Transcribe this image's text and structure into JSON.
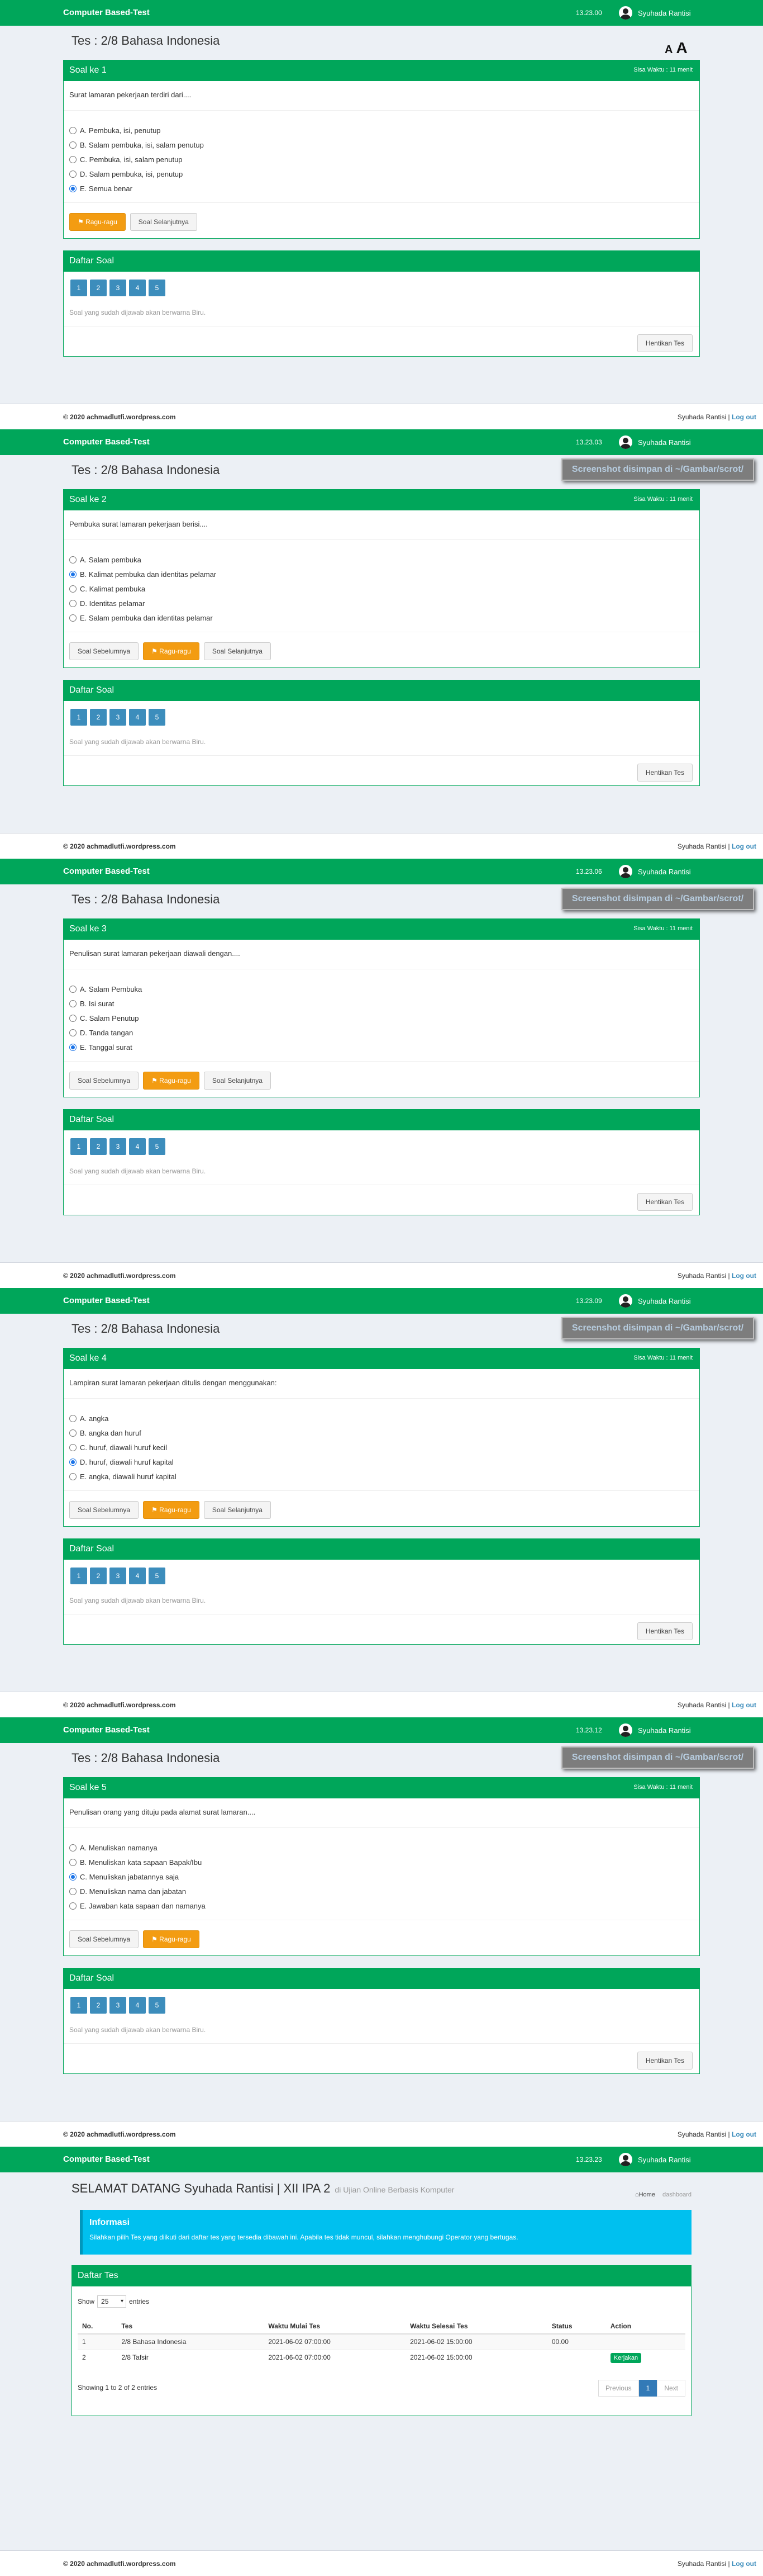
{
  "app": {
    "brand": "Computer Based-Test",
    "user": "Syuhada Rantisi",
    "logout": "Log out",
    "copyright": "© 2020 achmadlutfi.wordpress.com",
    "separator": "|"
  },
  "exam": {
    "title": "Tes : 2/8 Bahasa Indonesia",
    "font_small": "A",
    "font_big": "A",
    "list_title": "Daftar Soal",
    "list_note": "Soal yang sudah dijawab akan berwarna Biru.",
    "stop_button": "Hentikan Tes",
    "prev_button": "Soal Sebelumnya",
    "doubt_button": "Ragu-ragu",
    "next_button": "Soal Selanjutnya",
    "watermark": "Screenshot disimpan di ~/Gambar/scrot/",
    "numbers": [
      "1",
      "2",
      "3",
      "4",
      "5"
    ]
  },
  "questions": [
    {
      "clock": "13.23.00",
      "heading": "Soal ke 1",
      "time_left": "Sisa Waktu : 11 menit",
      "text": "Surat lamaran pekerjaan terdiri dari....",
      "options": [
        "A. Pembuka, isi, penutup",
        "B. Salam pembuka, isi, salam penutup",
        "C. Pembuka, isi, salam penutup",
        "D. Salam pembuka, isi, penutup",
        "E. Semua benar"
      ],
      "selected": 4
    },
    {
      "clock": "13.23.03",
      "heading": "Soal ke 2",
      "time_left": "Sisa Waktu : 11 menit",
      "text": "Pembuka surat lamaran pekerjaan berisi....",
      "options": [
        "A. Salam pembuka",
        "B. Kalimat pembuka dan identitas pelamar",
        "C. Kalimat pembuka",
        "D. Identitas pelamar",
        "E. Salam pembuka dan identitas pelamar"
      ],
      "selected": 1
    },
    {
      "clock": "13.23.06",
      "heading": "Soal ke 3",
      "time_left": "Sisa Waktu : 11 menit",
      "text": "Penulisan surat lamaran pekerjaan diawali dengan....",
      "options": [
        "A. Salam Pembuka",
        "B. Isi surat",
        "C. Salam Penutup",
        "D. Tanda tangan",
        "E. Tanggal surat"
      ],
      "selected": 4
    },
    {
      "clock": "13.23.09",
      "heading": "Soal ke 4",
      "time_left": "Sisa Waktu : 11 menit",
      "text": "Lampiran surat lamaran pekerjaan ditulis dengan menggunakan:",
      "options": [
        "A. angka",
        "B. angka dan huruf",
        "C. huruf, diawali huruf kecil",
        "D. huruf, diawali huruf kapital",
        "E. angka, diawali huruf kapital"
      ],
      "selected": 3
    },
    {
      "clock": "13.23.12",
      "heading": "Soal ke 5",
      "time_left": "Sisa Waktu : 11 menit",
      "text": "Penulisan orang yang dituju pada alamat surat lamaran....",
      "options": [
        "A. Menuliskan namanya",
        "B. Menuliskan kata sapaan Bapak/Ibu",
        "C. Menuliskan jabatannya saja",
        "D. Menuliskan nama dan jabatan",
        "E. Jawaban kata sapaan dan namanya"
      ],
      "selected": 2
    }
  ],
  "dashboard": {
    "clock": "13.23.23",
    "welcome": "SELAMAT DATANG Syuhada Rantisi | XII IPA 2",
    "welcome_sub": "di Ujian Online Berbasis Komputer",
    "crumb_home": "Home",
    "crumb_active": "dashboard",
    "info_title": "Informasi",
    "info_text": "Silahkan pilih Tes yang diikuti dari daftar tes yang tersedia dibawah ini. Apabila tes tidak muncul, silahkan menghubungi Operator yang bertugas.",
    "list_title": "Daftar Tes",
    "show_label": "Show",
    "show_value": "25",
    "entries_label": "entries",
    "columns": [
      "No.",
      "Tes",
      "Waktu Mulai Tes",
      "Waktu Selesai Tes",
      "Status",
      "Action"
    ],
    "rows": [
      {
        "no": "1",
        "tes": "2/8 Bahasa Indonesia",
        "mulai": "2021-06-02 07:00:00",
        "selesai": "2021-06-02 15:00:00",
        "status": "00.00",
        "action": ""
      },
      {
        "no": "2",
        "tes": "2/8 Tafsir",
        "mulai": "2021-06-02 07:00:00",
        "selesai": "2021-06-02 15:00:00",
        "status": "",
        "action": "Kerjakan"
      }
    ],
    "showing": "Showing 1 to 2 of 2 entries",
    "prev": "Previous",
    "page": "1",
    "next": "Next"
  }
}
